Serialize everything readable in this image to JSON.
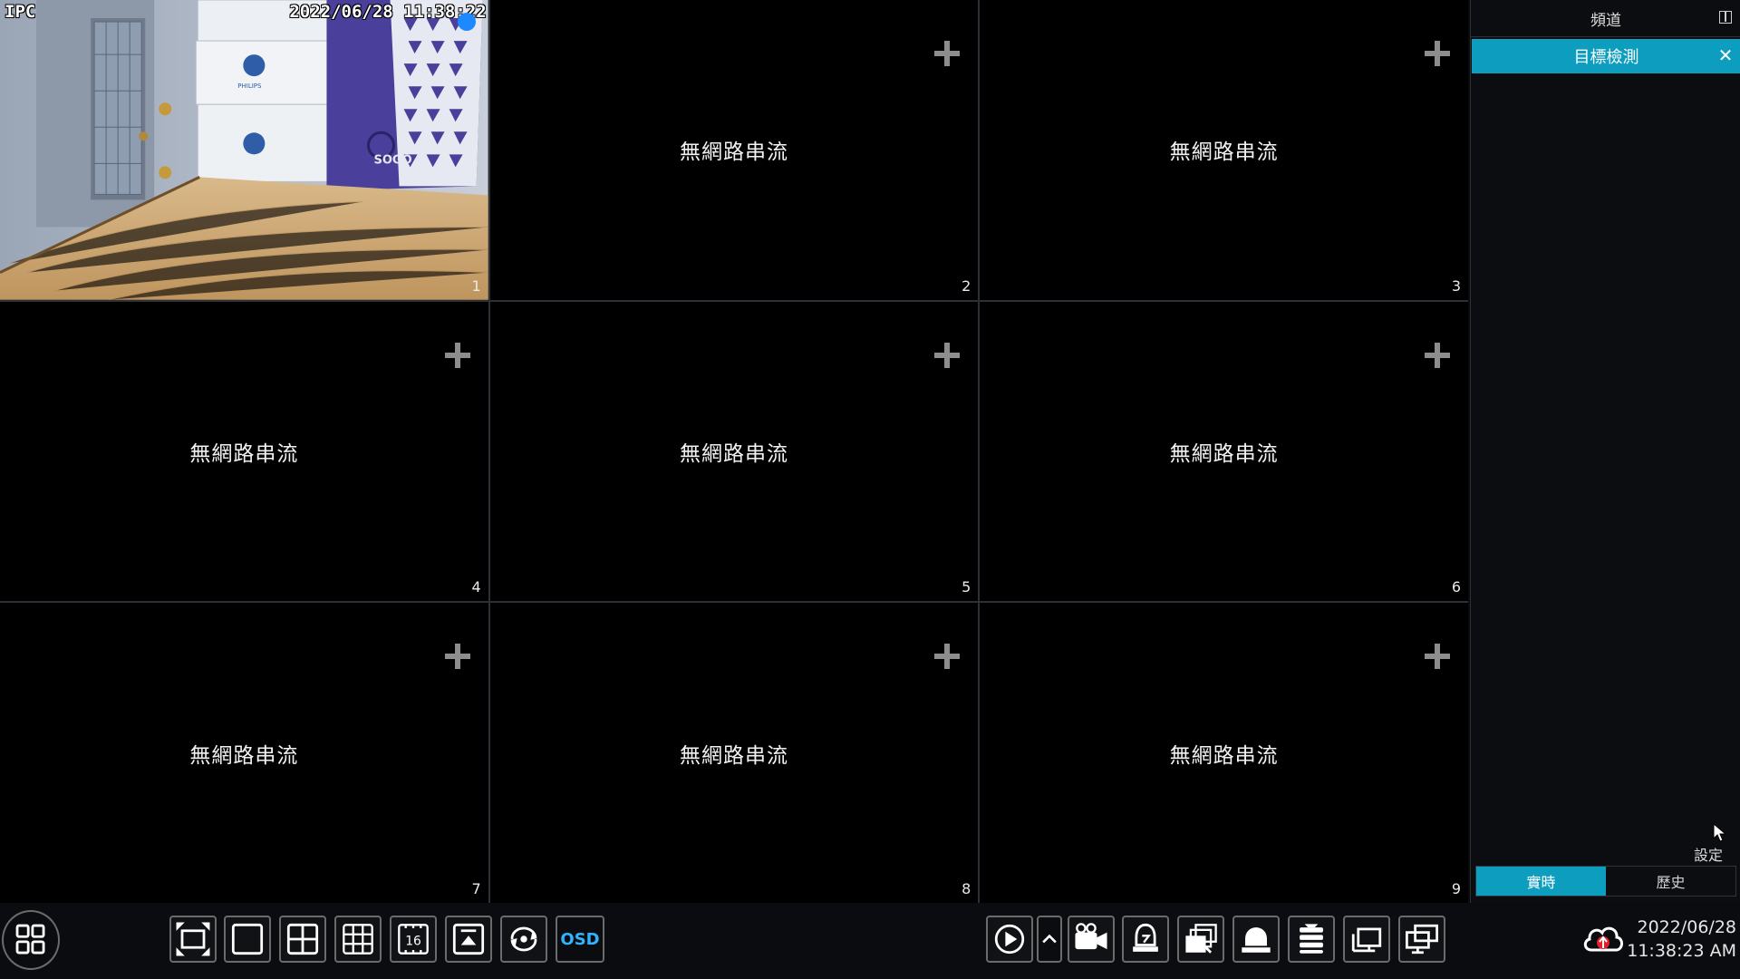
{
  "grid": {
    "cells": [
      {
        "number": "1",
        "live": true,
        "osd_name": "IPC",
        "osd_time": "2022/06/28  11:38:22"
      },
      {
        "number": "2",
        "live": false,
        "status": "無網路串流"
      },
      {
        "number": "3",
        "live": false,
        "status": "無網路串流"
      },
      {
        "number": "4",
        "live": false,
        "status": "無網路串流"
      },
      {
        "number": "5",
        "live": false,
        "status": "無網路串流"
      },
      {
        "number": "6",
        "live": false,
        "status": "無網路串流"
      },
      {
        "number": "7",
        "live": false,
        "status": "無網路串流"
      },
      {
        "number": "8",
        "live": false,
        "status": "無網路串流"
      },
      {
        "number": "9",
        "live": false,
        "status": "無網路串流"
      }
    ],
    "feed_labels": {
      "box_brand": "PHILIPS",
      "bag_brand": "SOGO"
    }
  },
  "panel": {
    "title": "頻道",
    "active_tab": "目標檢測",
    "settings_label": "設定",
    "modes": [
      {
        "label": "實時",
        "active": true
      },
      {
        "label": "歷史",
        "active": false
      }
    ]
  },
  "toolbar": {
    "osd_label": "OSD",
    "layout_16_label": "16",
    "date": "2022/06/28",
    "time": "11:38:23 AM"
  },
  "colors": {
    "accent": "#0d9ebf",
    "osd": "#2fb4ff",
    "rec_dot": "#1e88ff",
    "alarm": "#e0202a"
  }
}
